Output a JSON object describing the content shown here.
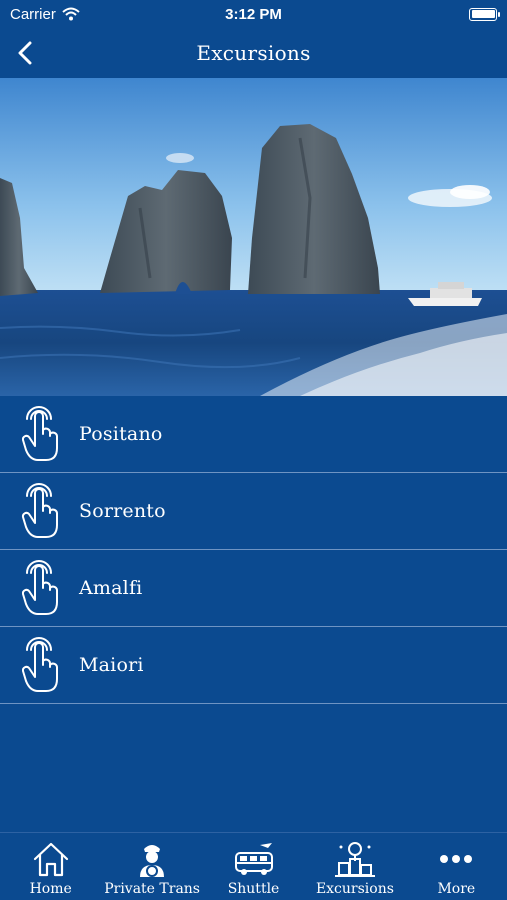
{
  "status_bar": {
    "carrier": "Carrier",
    "time": "3:12 PM"
  },
  "nav": {
    "title": "Excursions"
  },
  "excursions": [
    {
      "label": "Positano"
    },
    {
      "label": "Sorrento"
    },
    {
      "label": "Amalfi"
    },
    {
      "label": "Maiori"
    }
  ],
  "tabs": [
    {
      "label": "Home",
      "icon": "home-icon"
    },
    {
      "label": "Private Trans",
      "icon": "driver-icon"
    },
    {
      "label": "Shuttle",
      "icon": "shuttle-icon"
    },
    {
      "label": "Excursions",
      "icon": "excursions-icon"
    },
    {
      "label": "More",
      "icon": "more-icon"
    }
  ],
  "colors": {
    "background": "#0b4a90",
    "divider": "#6f94c3",
    "text": "#ffffff"
  }
}
